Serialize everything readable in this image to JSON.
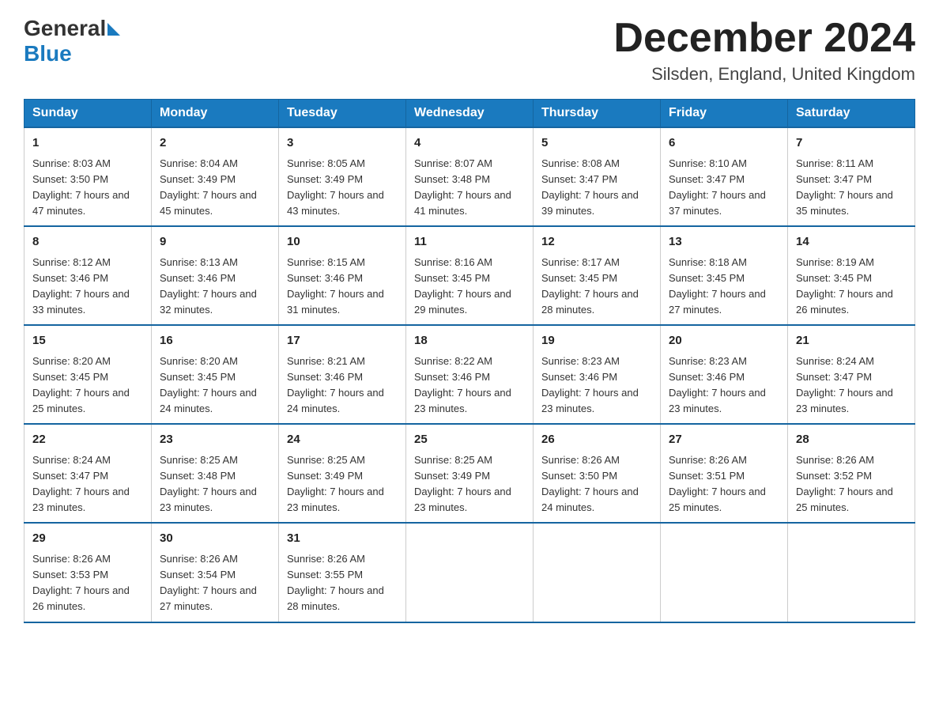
{
  "header": {
    "logo_general": "General",
    "logo_blue": "Blue",
    "title": "December 2024",
    "subtitle": "Silsden, England, United Kingdom"
  },
  "calendar": {
    "days_of_week": [
      "Sunday",
      "Monday",
      "Tuesday",
      "Wednesday",
      "Thursday",
      "Friday",
      "Saturday"
    ],
    "weeks": [
      [
        {
          "day": "1",
          "sunrise": "8:03 AM",
          "sunset": "3:50 PM",
          "daylight": "7 hours and 47 minutes."
        },
        {
          "day": "2",
          "sunrise": "8:04 AM",
          "sunset": "3:49 PM",
          "daylight": "7 hours and 45 minutes."
        },
        {
          "day": "3",
          "sunrise": "8:05 AM",
          "sunset": "3:49 PM",
          "daylight": "7 hours and 43 minutes."
        },
        {
          "day": "4",
          "sunrise": "8:07 AM",
          "sunset": "3:48 PM",
          "daylight": "7 hours and 41 minutes."
        },
        {
          "day": "5",
          "sunrise": "8:08 AM",
          "sunset": "3:47 PM",
          "daylight": "7 hours and 39 minutes."
        },
        {
          "day": "6",
          "sunrise": "8:10 AM",
          "sunset": "3:47 PM",
          "daylight": "7 hours and 37 minutes."
        },
        {
          "day": "7",
          "sunrise": "8:11 AM",
          "sunset": "3:47 PM",
          "daylight": "7 hours and 35 minutes."
        }
      ],
      [
        {
          "day": "8",
          "sunrise": "8:12 AM",
          "sunset": "3:46 PM",
          "daylight": "7 hours and 33 minutes."
        },
        {
          "day": "9",
          "sunrise": "8:13 AM",
          "sunset": "3:46 PM",
          "daylight": "7 hours and 32 minutes."
        },
        {
          "day": "10",
          "sunrise": "8:15 AM",
          "sunset": "3:46 PM",
          "daylight": "7 hours and 31 minutes."
        },
        {
          "day": "11",
          "sunrise": "8:16 AM",
          "sunset": "3:45 PM",
          "daylight": "7 hours and 29 minutes."
        },
        {
          "day": "12",
          "sunrise": "8:17 AM",
          "sunset": "3:45 PM",
          "daylight": "7 hours and 28 minutes."
        },
        {
          "day": "13",
          "sunrise": "8:18 AM",
          "sunset": "3:45 PM",
          "daylight": "7 hours and 27 minutes."
        },
        {
          "day": "14",
          "sunrise": "8:19 AM",
          "sunset": "3:45 PM",
          "daylight": "7 hours and 26 minutes."
        }
      ],
      [
        {
          "day": "15",
          "sunrise": "8:20 AM",
          "sunset": "3:45 PM",
          "daylight": "7 hours and 25 minutes."
        },
        {
          "day": "16",
          "sunrise": "8:20 AM",
          "sunset": "3:45 PM",
          "daylight": "7 hours and 24 minutes."
        },
        {
          "day": "17",
          "sunrise": "8:21 AM",
          "sunset": "3:46 PM",
          "daylight": "7 hours and 24 minutes."
        },
        {
          "day": "18",
          "sunrise": "8:22 AM",
          "sunset": "3:46 PM",
          "daylight": "7 hours and 23 minutes."
        },
        {
          "day": "19",
          "sunrise": "8:23 AM",
          "sunset": "3:46 PM",
          "daylight": "7 hours and 23 minutes."
        },
        {
          "day": "20",
          "sunrise": "8:23 AM",
          "sunset": "3:46 PM",
          "daylight": "7 hours and 23 minutes."
        },
        {
          "day": "21",
          "sunrise": "8:24 AM",
          "sunset": "3:47 PM",
          "daylight": "7 hours and 23 minutes."
        }
      ],
      [
        {
          "day": "22",
          "sunrise": "8:24 AM",
          "sunset": "3:47 PM",
          "daylight": "7 hours and 23 minutes."
        },
        {
          "day": "23",
          "sunrise": "8:25 AM",
          "sunset": "3:48 PM",
          "daylight": "7 hours and 23 minutes."
        },
        {
          "day": "24",
          "sunrise": "8:25 AM",
          "sunset": "3:49 PM",
          "daylight": "7 hours and 23 minutes."
        },
        {
          "day": "25",
          "sunrise": "8:25 AM",
          "sunset": "3:49 PM",
          "daylight": "7 hours and 23 minutes."
        },
        {
          "day": "26",
          "sunrise": "8:26 AM",
          "sunset": "3:50 PM",
          "daylight": "7 hours and 24 minutes."
        },
        {
          "day": "27",
          "sunrise": "8:26 AM",
          "sunset": "3:51 PM",
          "daylight": "7 hours and 25 minutes."
        },
        {
          "day": "28",
          "sunrise": "8:26 AM",
          "sunset": "3:52 PM",
          "daylight": "7 hours and 25 minutes."
        }
      ],
      [
        {
          "day": "29",
          "sunrise": "8:26 AM",
          "sunset": "3:53 PM",
          "daylight": "7 hours and 26 minutes."
        },
        {
          "day": "30",
          "sunrise": "8:26 AM",
          "sunset": "3:54 PM",
          "daylight": "7 hours and 27 minutes."
        },
        {
          "day": "31",
          "sunrise": "8:26 AM",
          "sunset": "3:55 PM",
          "daylight": "7 hours and 28 minutes."
        },
        null,
        null,
        null,
        null
      ]
    ]
  }
}
